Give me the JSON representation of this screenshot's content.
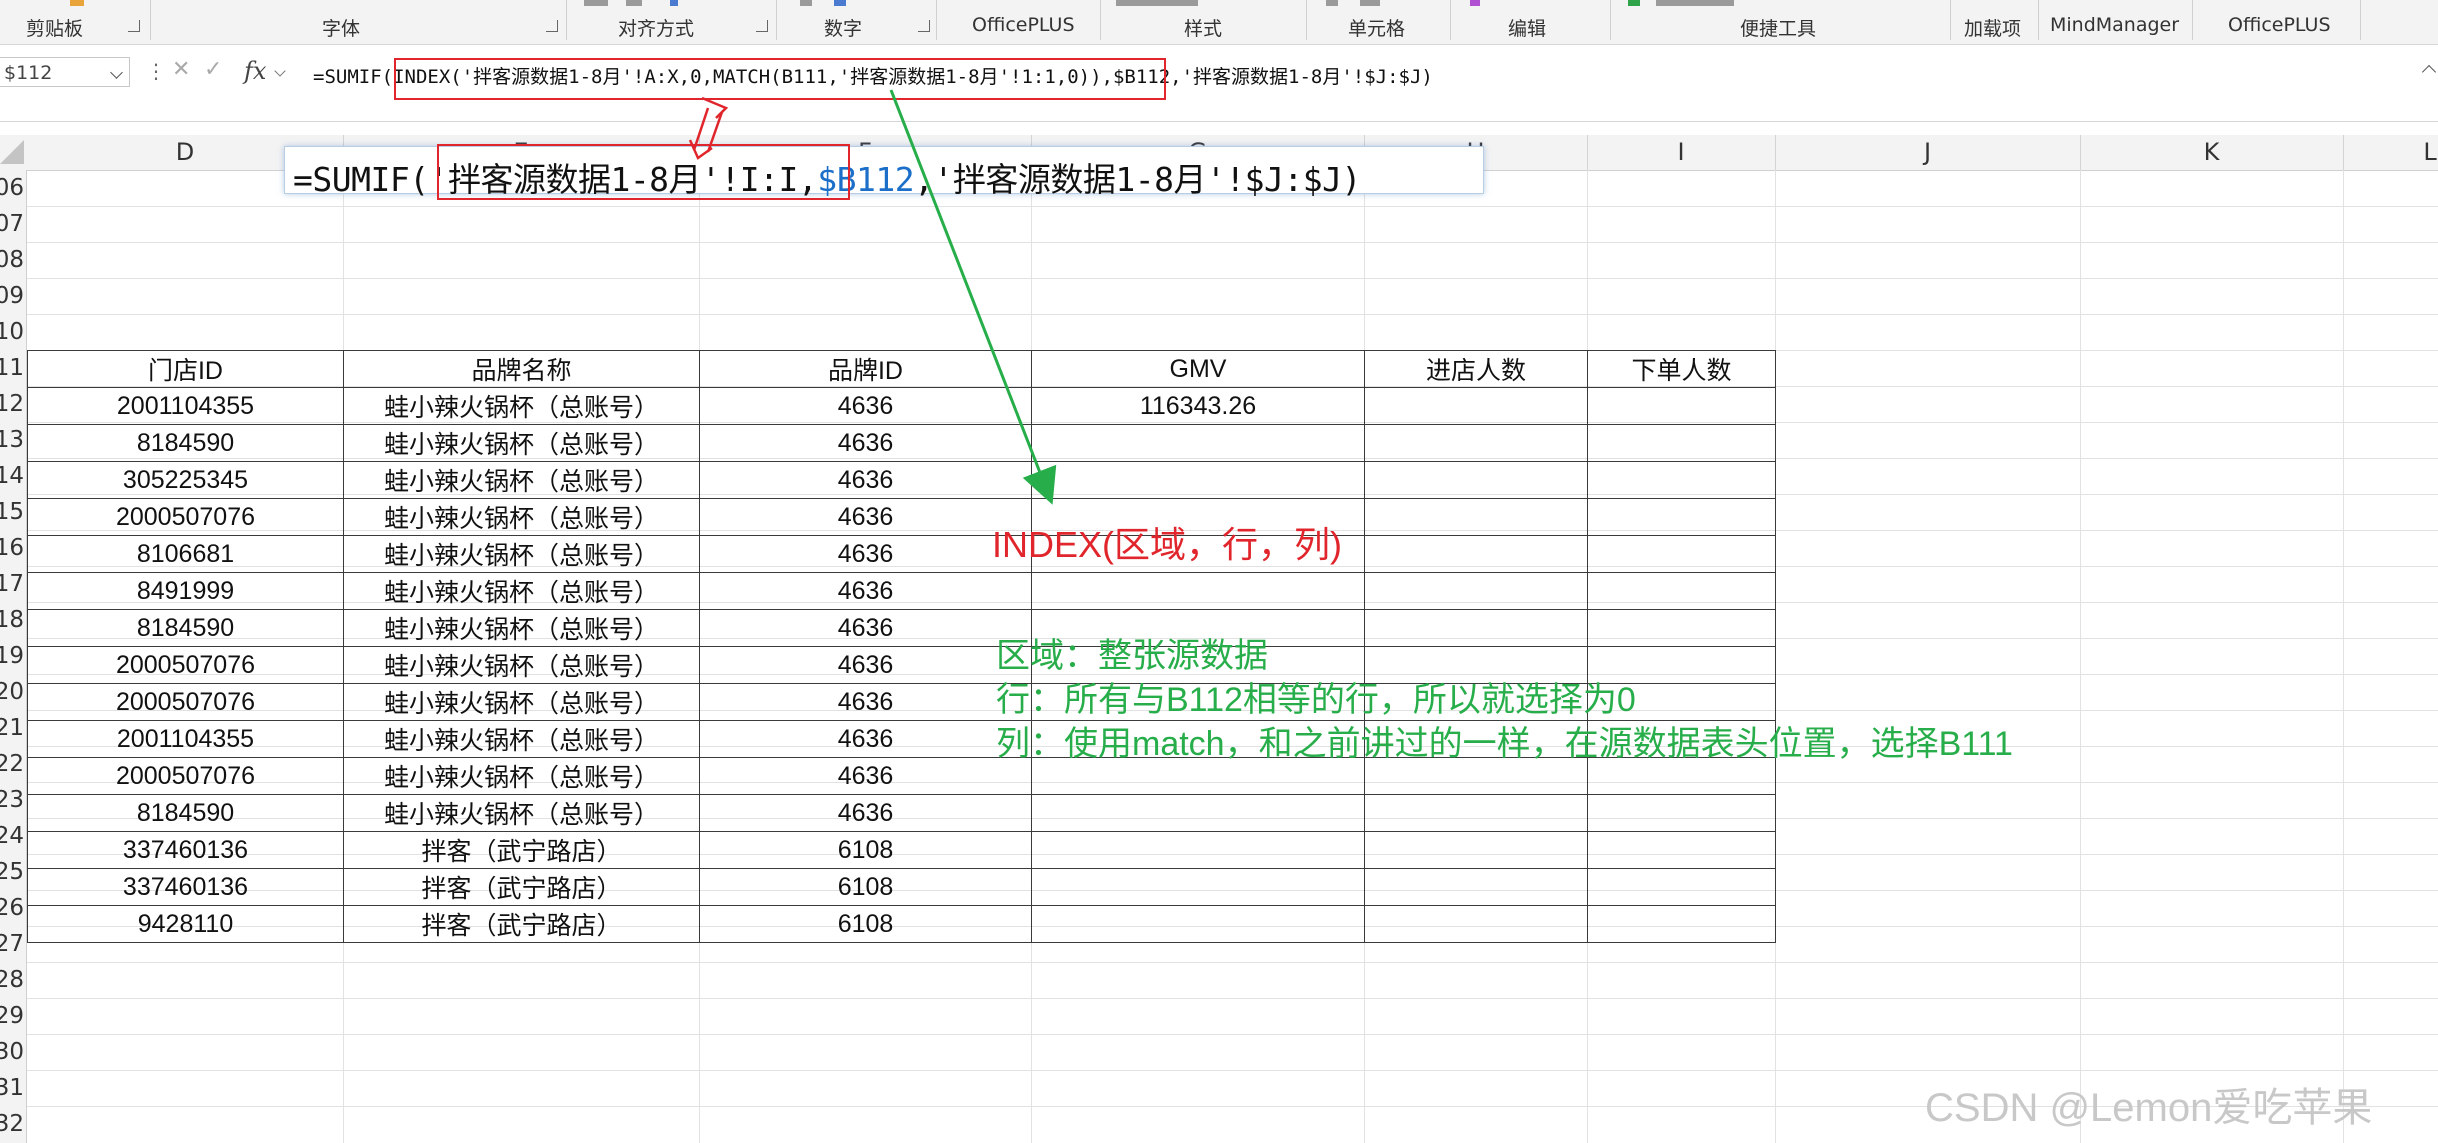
{
  "ribbon": {
    "groups": [
      "剪贴板",
      "字体",
      "对齐方式",
      "数字",
      "OfficePLUS",
      "样式",
      "单元格",
      "编辑",
      "便捷工具",
      "加载项",
      "MindManager",
      "OfficePLUS"
    ]
  },
  "formula_bar": {
    "name_box": "$112",
    "fx_label": "fx",
    "formula_parts": {
      "prefix": "=SUMIF(",
      "highlight": "INDEX('拌客源数据1-8月'!A:X,0,MATCH(B111,'拌客源数据1-8月'!1:1,0))",
      "suffix": ",$B112,'拌客源数据1-8月'!$J:$J)"
    }
  },
  "columns": [
    "D",
    "E",
    "F",
    "G",
    "H",
    "I",
    "J",
    "K",
    "L"
  ],
  "rows": [
    "06",
    "07",
    "08",
    "09",
    "10",
    "11",
    "12",
    "13",
    "14",
    "15",
    "16",
    "17",
    "18",
    "19",
    "20",
    "21",
    "22",
    "23",
    "24",
    "25",
    "26",
    "27",
    "28",
    "29",
    "30",
    "31",
    "32"
  ],
  "table": {
    "headers": [
      "门店ID",
      "品牌名称",
      "品牌ID",
      "GMV",
      "进店人数",
      "下单人数"
    ],
    "rows": [
      [
        "2001104355",
        "蛙小辣火锅杯（总账号）",
        "4636",
        "116343.26",
        "",
        ""
      ],
      [
        "8184590",
        "蛙小辣火锅杯（总账号）",
        "4636",
        "",
        "",
        ""
      ],
      [
        "305225345",
        "蛙小辣火锅杯（总账号）",
        "4636",
        "",
        "",
        ""
      ],
      [
        "2000507076",
        "蛙小辣火锅杯（总账号）",
        "4636",
        "",
        "",
        ""
      ],
      [
        "8106681",
        "蛙小辣火锅杯（总账号）",
        "4636",
        "",
        "",
        ""
      ],
      [
        "8491999",
        "蛙小辣火锅杯（总账号）",
        "4636",
        "",
        "",
        ""
      ],
      [
        "8184590",
        "蛙小辣火锅杯（总账号）",
        "4636",
        "",
        "",
        ""
      ],
      [
        "2000507076",
        "蛙小辣火锅杯（总账号）",
        "4636",
        "",
        "",
        ""
      ],
      [
        "2000507076",
        "蛙小辣火锅杯（总账号）",
        "4636",
        "",
        "",
        ""
      ],
      [
        "2001104355",
        "蛙小辣火锅杯（总账号）",
        "4636",
        "",
        "",
        ""
      ],
      [
        "2000507076",
        "蛙小辣火锅杯（总账号）",
        "4636",
        "",
        "",
        ""
      ],
      [
        "8184590",
        "蛙小辣火锅杯（总账号）",
        "4636",
        "",
        "",
        ""
      ],
      [
        "337460136",
        "拌客（武宁路店）",
        "6108",
        "",
        "",
        ""
      ],
      [
        "337460136",
        "拌客（武宁路店）",
        "6108",
        "",
        "",
        ""
      ],
      [
        "9428110",
        "拌客（武宁路店）",
        "6108",
        "",
        "",
        ""
      ]
    ]
  },
  "tooltip": {
    "prefix": "=SUMIF(",
    "range": "'拌客源数据1-8月'!I:I",
    "sep": ",",
    "ref": "$B112",
    "suffix": ",'拌客源数据1-8月'!$J:$J)"
  },
  "annotations": {
    "index_syntax": "INDEX(区域，行，列)",
    "area": "区域：整张源数据",
    "row": "行：所有与B112相等的行，所以就选择为0",
    "column": "列：使用match，和之前讲过的一样，在源数据表头位置，选择B111"
  },
  "colors": {
    "red": "#e0262c",
    "green": "#27ae4a",
    "ref_blue": "#1b6fc9"
  },
  "watermark": "CSDN @Lemon爱吃苹果"
}
